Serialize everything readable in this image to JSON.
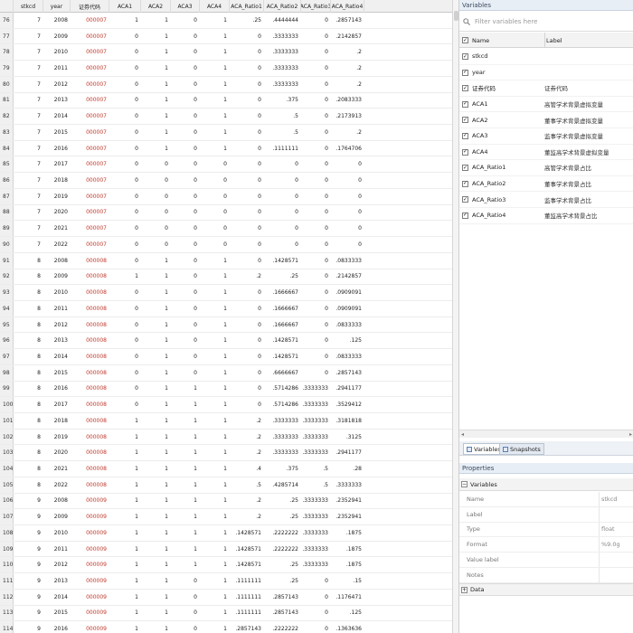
{
  "grid": {
    "columns": [
      {
        "key": "stkcd",
        "label": "stkcd"
      },
      {
        "key": "year",
        "label": "year"
      },
      {
        "key": "code",
        "label": "证券代码"
      },
      {
        "key": "ACA1",
        "label": "ACA1"
      },
      {
        "key": "ACA2",
        "label": "ACA2"
      },
      {
        "key": "ACA3",
        "label": "ACA3"
      },
      {
        "key": "ACA4",
        "label": "ACA4"
      },
      {
        "key": "r1",
        "label": "ACA_Ratio1"
      },
      {
        "key": "r2",
        "label": "ACA_Ratio2"
      },
      {
        "key": "r3",
        "label": "ACA_Ratio3"
      },
      {
        "key": "r4",
        "label": "ACA_Ratio4"
      }
    ],
    "rows": [
      [
        "76",
        "7",
        "2008",
        "000007",
        "1",
        "1",
        "0",
        "1",
        ".25",
        ".4444444",
        "0",
        ".2857143"
      ],
      [
        "77",
        "7",
        "2009",
        "000007",
        "0",
        "1",
        "0",
        "1",
        "0",
        ".3333333",
        "0",
        ".2142857"
      ],
      [
        "78",
        "7",
        "2010",
        "000007",
        "0",
        "1",
        "0",
        "1",
        "0",
        ".3333333",
        "0",
        ".2"
      ],
      [
        "79",
        "7",
        "2011",
        "000007",
        "0",
        "1",
        "0",
        "1",
        "0",
        ".3333333",
        "0",
        ".2"
      ],
      [
        "80",
        "7",
        "2012",
        "000007",
        "0",
        "1",
        "0",
        "1",
        "0",
        ".3333333",
        "0",
        ".2"
      ],
      [
        "81",
        "7",
        "2013",
        "000007",
        "0",
        "1",
        "0",
        "1",
        "0",
        ".375",
        "0",
        ".2083333"
      ],
      [
        "82",
        "7",
        "2014",
        "000007",
        "0",
        "1",
        "0",
        "1",
        "0",
        ".5",
        "0",
        ".2173913"
      ],
      [
        "83",
        "7",
        "2015",
        "000007",
        "0",
        "1",
        "0",
        "1",
        "0",
        ".5",
        "0",
        ".2"
      ],
      [
        "84",
        "7",
        "2016",
        "000007",
        "0",
        "1",
        "0",
        "1",
        "0",
        ".1111111",
        "0",
        ".1764706"
      ],
      [
        "85",
        "7",
        "2017",
        "000007",
        "0",
        "0",
        "0",
        "0",
        "0",
        "0",
        "0",
        "0"
      ],
      [
        "86",
        "7",
        "2018",
        "000007",
        "0",
        "0",
        "0",
        "0",
        "0",
        "0",
        "0",
        "0"
      ],
      [
        "87",
        "7",
        "2019",
        "000007",
        "0",
        "0",
        "0",
        "0",
        "0",
        "0",
        "0",
        "0"
      ],
      [
        "88",
        "7",
        "2020",
        "000007",
        "0",
        "0",
        "0",
        "0",
        "0",
        "0",
        "0",
        "0"
      ],
      [
        "89",
        "7",
        "2021",
        "000007",
        "0",
        "0",
        "0",
        "0",
        "0",
        "0",
        "0",
        "0"
      ],
      [
        "90",
        "7",
        "2022",
        "000007",
        "0",
        "0",
        "0",
        "0",
        "0",
        "0",
        "0",
        "0"
      ],
      [
        "91",
        "8",
        "2008",
        "000008",
        "0",
        "1",
        "0",
        "1",
        "0",
        ".1428571",
        "0",
        ".0833333"
      ],
      [
        "92",
        "8",
        "2009",
        "000008",
        "1",
        "1",
        "0",
        "1",
        ".2",
        ".25",
        "0",
        ".2142857"
      ],
      [
        "93",
        "8",
        "2010",
        "000008",
        "0",
        "1",
        "0",
        "1",
        "0",
        ".1666667",
        "0",
        ".0909091"
      ],
      [
        "94",
        "8",
        "2011",
        "000008",
        "0",
        "1",
        "0",
        "1",
        "0",
        ".1666667",
        "0",
        ".0909091"
      ],
      [
        "95",
        "8",
        "2012",
        "000008",
        "0",
        "1",
        "0",
        "1",
        "0",
        ".1666667",
        "0",
        ".0833333"
      ],
      [
        "96",
        "8",
        "2013",
        "000008",
        "0",
        "1",
        "0",
        "1",
        "0",
        ".1428571",
        "0",
        ".125"
      ],
      [
        "97",
        "8",
        "2014",
        "000008",
        "0",
        "1",
        "0",
        "1",
        "0",
        ".1428571",
        "0",
        ".0833333"
      ],
      [
        "98",
        "8",
        "2015",
        "000008",
        "0",
        "1",
        "0",
        "1",
        "0",
        ".6666667",
        "0",
        ".2857143"
      ],
      [
        "99",
        "8",
        "2016",
        "000008",
        "0",
        "1",
        "1",
        "1",
        "0",
        ".5714286",
        ".3333333",
        ".2941177"
      ],
      [
        "100",
        "8",
        "2017",
        "000008",
        "0",
        "1",
        "1",
        "1",
        "0",
        ".5714286",
        ".3333333",
        ".3529412"
      ],
      [
        "101",
        "8",
        "2018",
        "000008",
        "1",
        "1",
        "1",
        "1",
        ".2",
        ".3333333",
        ".3333333",
        ".3181818"
      ],
      [
        "102",
        "8",
        "2019",
        "000008",
        "1",
        "1",
        "1",
        "1",
        ".2",
        ".3333333",
        ".3333333",
        ".3125"
      ],
      [
        "103",
        "8",
        "2020",
        "000008",
        "1",
        "1",
        "1",
        "1",
        ".2",
        ".3333333",
        ".3333333",
        ".2941177"
      ],
      [
        "104",
        "8",
        "2021",
        "000008",
        "1",
        "1",
        "1",
        "1",
        ".4",
        ".375",
        ".5",
        ".28"
      ],
      [
        "105",
        "8",
        "2022",
        "000008",
        "1",
        "1",
        "1",
        "1",
        ".5",
        ".4285714",
        ".5",
        ".3333333"
      ],
      [
        "106",
        "9",
        "2008",
        "000009",
        "1",
        "1",
        "1",
        "1",
        ".2",
        ".25",
        ".3333333",
        ".2352941"
      ],
      [
        "107",
        "9",
        "2009",
        "000009",
        "1",
        "1",
        "1",
        "1",
        ".2",
        ".25",
        ".3333333",
        ".2352941"
      ],
      [
        "108",
        "9",
        "2010",
        "000009",
        "1",
        "1",
        "1",
        "1",
        ".1428571",
        ".2222222",
        ".3333333",
        ".1875"
      ],
      [
        "109",
        "9",
        "2011",
        "000009",
        "1",
        "1",
        "1",
        "1",
        ".1428571",
        ".2222222",
        ".3333333",
        ".1875"
      ],
      [
        "110",
        "9",
        "2012",
        "000009",
        "1",
        "1",
        "1",
        "1",
        ".1428571",
        ".25",
        ".3333333",
        ".1875"
      ],
      [
        "111",
        "9",
        "2013",
        "000009",
        "1",
        "1",
        "0",
        "1",
        ".1111111",
        ".25",
        "0",
        ".15"
      ],
      [
        "112",
        "9",
        "2014",
        "000009",
        "1",
        "1",
        "0",
        "1",
        ".1111111",
        ".2857143",
        "0",
        ".1176471"
      ],
      [
        "113",
        "9",
        "2015",
        "000009",
        "1",
        "1",
        "0",
        "1",
        ".1111111",
        ".2857143",
        "0",
        ".125"
      ],
      [
        "114",
        "9",
        "2016",
        "000009",
        "1",
        "1",
        "0",
        "1",
        ".2857143",
        ".2222222",
        "0",
        ".1363636"
      ]
    ]
  },
  "variables_panel": {
    "title": "Variables",
    "filter_placeholder": "Filter variables here",
    "col_name": "Name",
    "col_label": "Label",
    "items": [
      {
        "name": "stkcd",
        "label": ""
      },
      {
        "name": "year",
        "label": ""
      },
      {
        "name": "证券代码",
        "label": "证券代码"
      },
      {
        "name": "ACA1",
        "label": "高管学术背景虚拟变量"
      },
      {
        "name": "ACA2",
        "label": "董事学术背景虚拟变量"
      },
      {
        "name": "ACA3",
        "label": "监事学术背景虚拟变量"
      },
      {
        "name": "ACA4",
        "label": "董监高学术背景虚拟变量"
      },
      {
        "name": "ACA_Ratio1",
        "label": "高管学术背景占比"
      },
      {
        "name": "ACA_Ratio2",
        "label": "董事学术背景占比"
      },
      {
        "name": "ACA_Ratio3",
        "label": "监事学术背景占比"
      },
      {
        "name": "ACA_Ratio4",
        "label": "董监高学术背景占比"
      }
    ],
    "tabs": [
      "Variables",
      "Snapshots"
    ]
  },
  "properties_panel": {
    "title": "Properties",
    "section_variables": "Variables",
    "section_data": "Data",
    "rows": [
      {
        "key": "Name",
        "value": "stkcd"
      },
      {
        "key": "Label",
        "value": ""
      },
      {
        "key": "Type",
        "value": "float"
      },
      {
        "key": "Format",
        "value": "%9.0g"
      },
      {
        "key": "Value label",
        "value": ""
      },
      {
        "key": "Notes",
        "value": ""
      }
    ]
  },
  "colors": {
    "code_text": "#c0392b",
    "panel_title_bg": "#e8eef6"
  }
}
